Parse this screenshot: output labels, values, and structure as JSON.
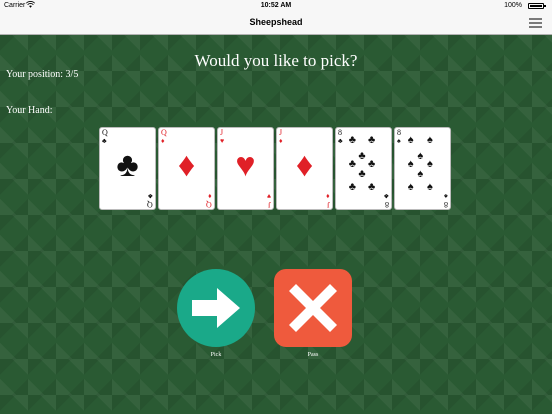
{
  "status_bar": {
    "carrier": "Carrier",
    "wifi_icon": "wifi-icon",
    "time": "10:52 AM",
    "battery": "100%"
  },
  "nav": {
    "title": "Sheepshead",
    "menu_icon": "hamburger-menu-icon"
  },
  "game": {
    "prompt": "Would you like to pick?",
    "position": "Your position: 3/5",
    "hand_label": "Your Hand:",
    "hand": [
      {
        "rank": "Q",
        "suit": "♣",
        "suit_name": "clubs",
        "color": "black"
      },
      {
        "rank": "Q",
        "suit": "♦",
        "suit_name": "diamonds",
        "color": "red"
      },
      {
        "rank": "J",
        "suit": "♥",
        "suit_name": "hearts",
        "color": "red"
      },
      {
        "rank": "J",
        "suit": "♦",
        "suit_name": "diamonds",
        "color": "red"
      },
      {
        "rank": "8",
        "suit": "♣",
        "suit_name": "clubs",
        "color": "black"
      },
      {
        "rank": "8",
        "suit": "♠",
        "suit_name": "spades",
        "color": "black"
      }
    ],
    "pick": {
      "label": "Pick",
      "icon": "arrow-right-icon",
      "color": "#1aa989"
    },
    "pass": {
      "label": "Pass",
      "icon": "x-cross-icon",
      "color": "#ef5a3d"
    }
  }
}
